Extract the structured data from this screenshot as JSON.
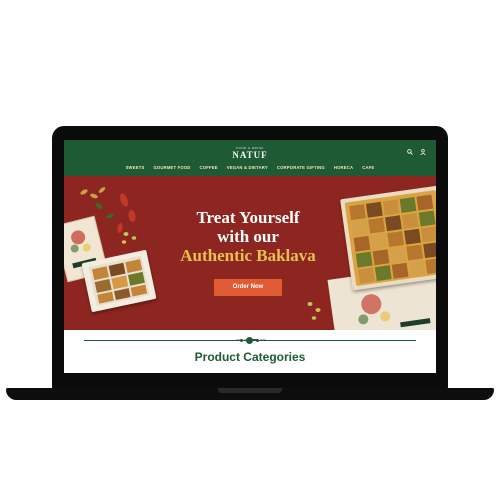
{
  "brand": {
    "tagline": "FOOD & DRINK",
    "logo": "NATUF"
  },
  "nav": {
    "items": [
      "SWEETS",
      "GOURMET FOOD",
      "COFFEE",
      "VEGAN & DIETARY",
      "CORPORATE GIFTING",
      "HORECA",
      "CAFE"
    ]
  },
  "icons": {
    "search": "search-icon",
    "account": "user-icon"
  },
  "hero": {
    "line1": "Treat Yourself",
    "line2": "with our",
    "line3": "Authentic Baklava",
    "cta_label": "Order Now",
    "slides": 4,
    "active_slide": 2
  },
  "section": {
    "title": "Product Categories"
  },
  "colors": {
    "brand_green": "#1e5a33",
    "hero_red": "#8d2620",
    "accent_gold": "#e9c04f",
    "cta_orange": "#e05b31",
    "nav_text": "#f6e6c2"
  }
}
